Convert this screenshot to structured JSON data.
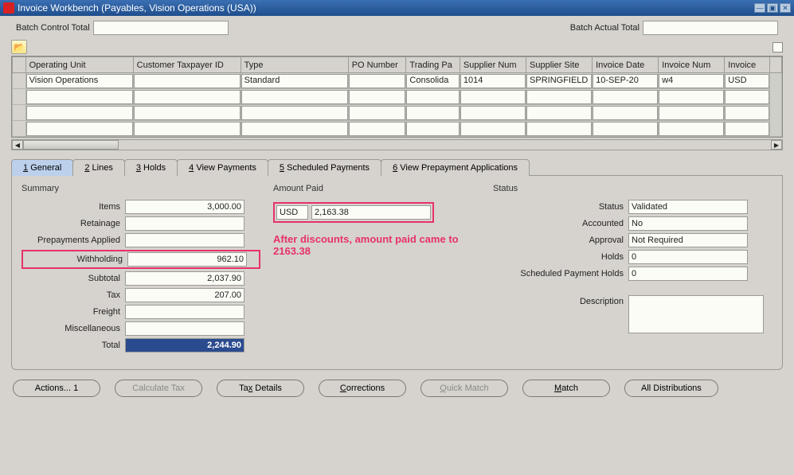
{
  "title": "Invoice Workbench (Payables, Vision Operations (USA))",
  "batch": {
    "control_label": "Batch Control Total",
    "control_value": "",
    "actual_label": "Batch Actual Total",
    "actual_value": ""
  },
  "grid": {
    "headers": [
      "Operating Unit",
      "Customer Taxpayer ID",
      "Type",
      "PO Number",
      "Trading Pa",
      "Supplier Num",
      "Supplier Site",
      "Invoice Date",
      "Invoice Num",
      "Invoice"
    ],
    "row": {
      "operating_unit": "Vision Operations",
      "taxpayer": "",
      "type": "Standard",
      "po_number": "",
      "trading": "Consolida",
      "supplier_num": "1014",
      "supplier_site": "SPRINGFIELD",
      "invoice_date": "10-SEP-20",
      "invoice_num": "w4",
      "invoice_curr": "USD"
    }
  },
  "tabs": {
    "t1": "General",
    "t1n": "1",
    "t2": "Lines",
    "t2n": "2",
    "t3": "Holds",
    "t3n": "3",
    "t4": "View Payments",
    "t4n": "4",
    "t5": "Scheduled Payments",
    "t5n": "5",
    "t6": "View Prepayment Applications",
    "t6n": "6"
  },
  "summary": {
    "title": "Summary",
    "items_label": "Items",
    "items": "3,000.00",
    "retainage_label": "Retainage",
    "retainage": "",
    "prepay_label": "Prepayments Applied",
    "prepay": "",
    "withholding_label": "Withholding",
    "withholding": "962.10",
    "subtotal_label": "Subtotal",
    "subtotal": "2,037.90",
    "tax_label": "Tax",
    "tax": "207.00",
    "freight_label": "Freight",
    "freight": "",
    "misc_label": "Miscellaneous",
    "misc": "",
    "total_label": "Total",
    "total": "2,244.90"
  },
  "amount_paid": {
    "title": "Amount Paid",
    "currency": "USD",
    "value": "2,163.38"
  },
  "annotation": "After discounts, amount paid came to 2163.38",
  "status": {
    "title": "Status",
    "status_label": "Status",
    "status": "Validated",
    "accounted_label": "Accounted",
    "accounted": "No",
    "approval_label": "Approval",
    "approval": "Not Required",
    "holds_label": "Holds",
    "holds": "0",
    "sph_label": "Scheduled Payment Holds",
    "sph": "0",
    "desc_label": "Description",
    "desc": ""
  },
  "buttons": {
    "actions": "Actions... 1",
    "calc_tax": "Calculate Tax",
    "tax_details": "Tax Details",
    "corrections": "Corrections",
    "quick_match": "Quick Match",
    "match": "Match",
    "all_dist": "All Distributions"
  }
}
